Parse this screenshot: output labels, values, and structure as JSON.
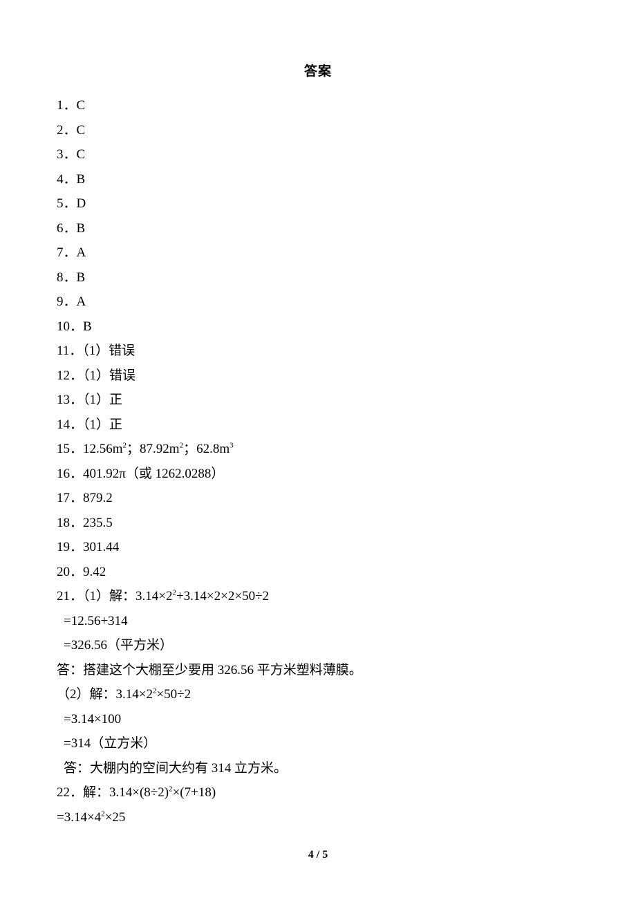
{
  "title": "答案",
  "lines": [
    {
      "indent": 0,
      "t": "1．C"
    },
    {
      "indent": 0,
      "t": "2．C"
    },
    {
      "indent": 0,
      "t": "3．C"
    },
    {
      "indent": 0,
      "t": "4．B"
    },
    {
      "indent": 0,
      "t": "5．D"
    },
    {
      "indent": 0,
      "t": "6．B"
    },
    {
      "indent": 0,
      "t": "7．A"
    },
    {
      "indent": 0,
      "t": "8．B"
    },
    {
      "indent": 0,
      "t": "9．A"
    },
    {
      "indent": 0,
      "t": "10．B"
    },
    {
      "indent": 0,
      "t": "11．（1）错误"
    },
    {
      "indent": 0,
      "t": "12．（1）错误"
    },
    {
      "indent": 0,
      "t": "13．（1）正"
    },
    {
      "indent": 0,
      "t": "14．（1）正"
    },
    {
      "indent": 0,
      "html": "15．12.56m<sup>2</sup>；87.92m<sup>2</sup>；62.8m<sup>3</sup>"
    },
    {
      "indent": 0,
      "t": "16．401.92π（或 1262.0288）"
    },
    {
      "indent": 0,
      "t": "17．879.2"
    },
    {
      "indent": 0,
      "t": "18．235.5"
    },
    {
      "indent": 0,
      "t": "19．301.44"
    },
    {
      "indent": 0,
      "t": "20．9.42"
    },
    {
      "indent": 0,
      "html": "21．（1）解：3.14×2<sup>2</sup>+3.14×2×2×50÷2"
    },
    {
      "indent": 1,
      "t": "=12.56+314"
    },
    {
      "indent": 1,
      "t": "=326.56（平方米）"
    },
    {
      "indent": 0,
      "t": "答：搭建这个大棚至少要用 326.56 平方米塑料薄膜。"
    },
    {
      "indent": 0,
      "html": "（2）解：3.14×2<sup>2</sup>×50÷2"
    },
    {
      "indent": 1,
      "t": "=3.14×100"
    },
    {
      "indent": 1,
      "t": "=314（立方米）"
    },
    {
      "indent": 1,
      "t": "答：大棚内的空间大约有 314 立方米。"
    },
    {
      "indent": 0,
      "html": "22．解：3.14×(8÷2)<sup>2</sup>×(7+18)"
    },
    {
      "indent": 0,
      "html": "=3.14×4<sup>2</sup>×25"
    }
  ],
  "footer": "4 / 5",
  "chart_data": {
    "type": "table",
    "title": "答案",
    "answers_mc": {
      "1": "C",
      "2": "C",
      "3": "C",
      "4": "B",
      "5": "D",
      "6": "B",
      "7": "A",
      "8": "B",
      "9": "A",
      "10": "B"
    },
    "answers_tf": {
      "11": "错误",
      "12": "错误",
      "13": "正",
      "14": "正"
    },
    "answers_fill": {
      "15": [
        "12.56m²",
        "87.92m²",
        "62.8m³"
      ],
      "16": "401.92π（或 1262.0288）",
      "17": 879.2,
      "18": 235.5,
      "19": 301.44,
      "20": 9.42
    },
    "answers_work": {
      "21": {
        "part1": {
          "expression": "3.14×2²+3.14×2×2×50÷2",
          "steps": [
            "=12.56+314",
            "=326.56（平方米）"
          ],
          "statement": "答：搭建这个大棚至少要用 326.56 平方米塑料薄膜。"
        },
        "part2": {
          "expression": "3.14×2²×50÷2",
          "steps": [
            "=3.14×100",
            "=314（立方米）"
          ],
          "statement": "答：大棚内的空间大约有 314 立方米。"
        }
      },
      "22": {
        "expression": "3.14×(8÷2)²×(7+18)",
        "steps": [
          "=3.14×4²×25"
        ]
      }
    },
    "page": "4 / 5"
  }
}
